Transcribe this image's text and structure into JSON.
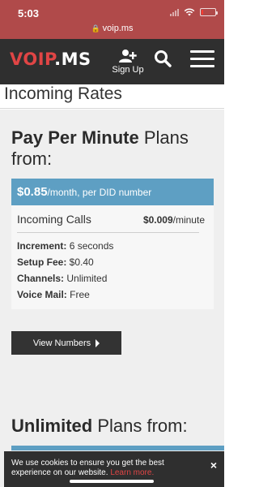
{
  "status": {
    "time": "5:03",
    "battery_level": 0.15
  },
  "browser": {
    "url": "voip.ms"
  },
  "header": {
    "logo_red": "VOIP",
    "logo_rest": ".MS",
    "signup_label": "Sign Up"
  },
  "page": {
    "title": "Incoming Rates"
  },
  "per_minute": {
    "heading_bold": "Pay Per Minute",
    "heading_rest": " Plans",
    "heading_line2": "from:",
    "price_amount": "$0.85",
    "price_suffix": "/month, per DID number",
    "incoming_calls_label": "Incoming Calls",
    "incoming_calls_rate": "$0.009",
    "incoming_calls_unit": "/minute",
    "details": [
      {
        "label": "Increment:",
        "value": " 6 seconds"
      },
      {
        "label": "Setup Fee:",
        "value": " $0.40"
      },
      {
        "label": "Channels:",
        "value": " Unlimited"
      },
      {
        "label": "Voice Mail:",
        "value": " Free"
      }
    ],
    "view_numbers_label": "View Numbers"
  },
  "unlimited": {
    "heading_bold": "Unlimited",
    "heading_rest": " Plans from:"
  },
  "cookie": {
    "message": "We use cookies to ensure you get the best experience on our website.",
    "learn_more": "Learn more.",
    "close_label": "×"
  },
  "colors": {
    "url_bar": "#b04a4a",
    "header": "#2f2f2f",
    "accent_blue": "#5e9fc3",
    "brand_red": "#e04545"
  }
}
